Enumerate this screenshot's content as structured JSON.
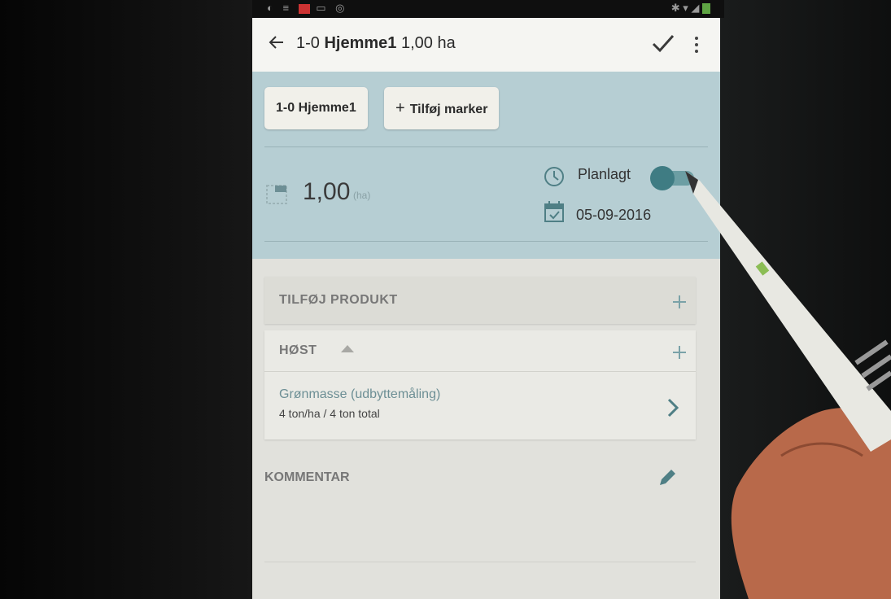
{
  "app_bar": {
    "field_code": "1-0",
    "field_name": "Hjemme1",
    "field_area": "1,00 ha"
  },
  "fields_row": {
    "field_chip": "1-0 Hjemme1",
    "add_fields_label": "Tilføj marker"
  },
  "summary": {
    "area_value": "1,00",
    "area_unit": "(ha)",
    "planned_label": "Planlagt",
    "planned_toggle_on": true,
    "date": "05-09-2016"
  },
  "add_product": {
    "label": "TILFØJ PRODUKT"
  },
  "harvest": {
    "label": "HØST",
    "item_name": "Grønmasse (udbyttemåling)",
    "item_amount": "4 ton/ha  /  4 ton total"
  },
  "comment": {
    "label": "KOMMENTAR"
  },
  "colors": {
    "accent": "#3f7c83",
    "header_band": "#b6ced3",
    "link_text": "#6d8f95"
  }
}
